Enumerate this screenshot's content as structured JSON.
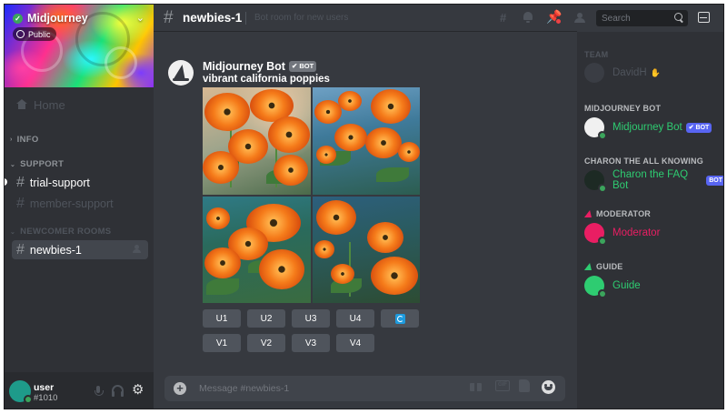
{
  "server": {
    "name": "Midjourney",
    "visibility": "Public",
    "accent": "#3ba55c"
  },
  "sidebar": {
    "home": "Home",
    "categories": {
      "info": "INFO",
      "support": "SUPPORT",
      "newcomer_rooms": "NEWCOMER ROOMS"
    },
    "channels": [
      {
        "name": "trial-support",
        "state": "unread"
      },
      {
        "name": "member-support",
        "state": "muted"
      },
      {
        "name": "newbies-1",
        "state": "active"
      }
    ]
  },
  "user_panel": {
    "name": "user",
    "tag": "#1010",
    "status_color": "#3ba55c"
  },
  "header": {
    "channel": "newbies-1",
    "topic": "Bot room for new users",
    "search_placeholder": "Search",
    "icons": [
      "threads-icon",
      "bell-icon",
      "pin-icon",
      "members-icon",
      "search-icon",
      "inbox-icon"
    ]
  },
  "message": {
    "author": "Midjourney Bot",
    "badge": "✔ BOT",
    "prompt": "vibrant california poppies",
    "upscale_buttons": [
      "U1",
      "U2",
      "U3",
      "U4"
    ],
    "variation_buttons": [
      "V1",
      "V2",
      "V3",
      "V4"
    ],
    "reroll_icon": "reroll-icon"
  },
  "composer": {
    "placeholder": "Message #newbies-1",
    "icons": [
      "plus-icon",
      "gift-icon",
      "gif-icon",
      "sticker-icon",
      "emoji-icon"
    ]
  },
  "members": {
    "groups": [
      {
        "role": "TEAM",
        "members": [
          {
            "name": "DavidH",
            "color": "#4f545c"
          }
        ]
      },
      {
        "role": "MIDJOURNEY BOT",
        "members": [
          {
            "name": "Midjourney Bot",
            "badge": "✔ BOT",
            "color": "#2ecc71"
          }
        ]
      },
      {
        "role": "CHARON THE ALL KNOWING",
        "members": [
          {
            "name": "Charon the FAQ Bot",
            "badge": "BOT",
            "color": "#2ecc71"
          }
        ]
      },
      {
        "role": "MODERATOR",
        "members": [
          {
            "name": "Moderator",
            "color": "#e91e63"
          }
        ]
      },
      {
        "role": "GUIDE",
        "members": [
          {
            "name": "Guide",
            "color": "#2ecc71"
          }
        ]
      }
    ]
  }
}
